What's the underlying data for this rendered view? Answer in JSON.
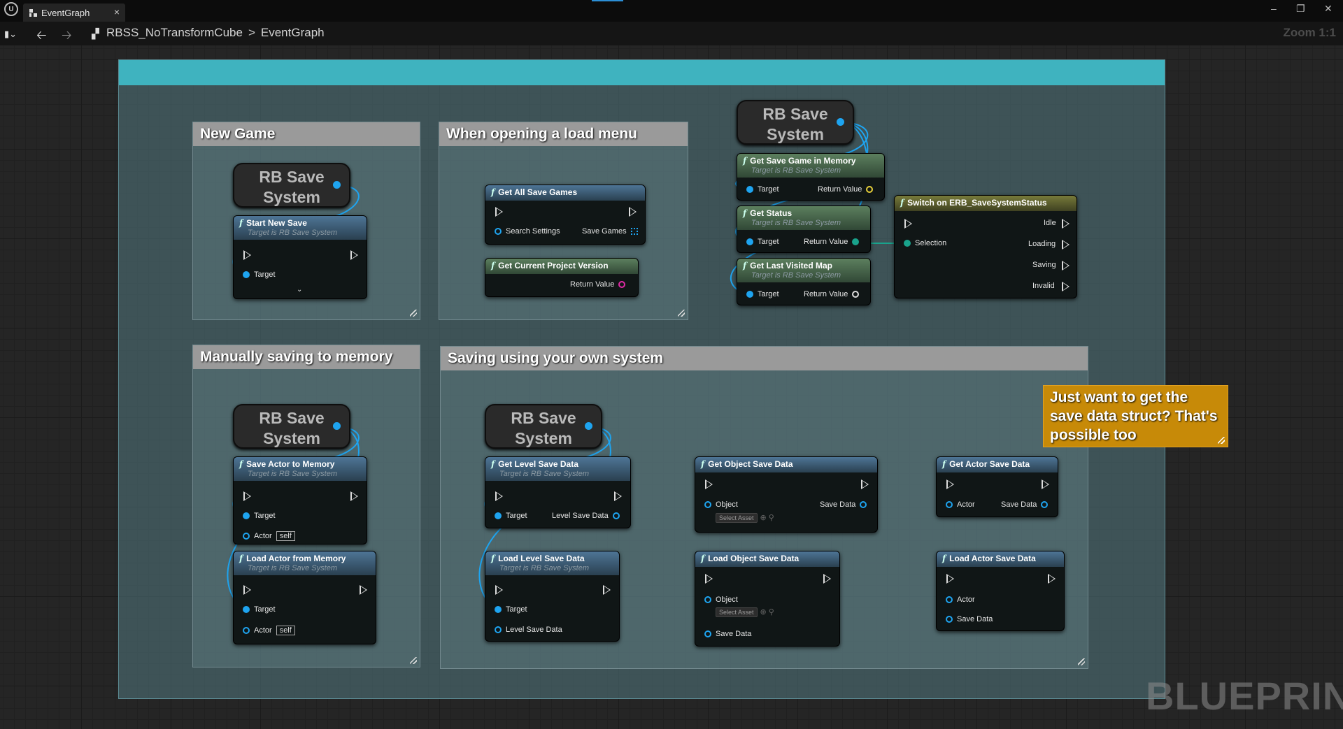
{
  "titlebar": {
    "tab_label": "EventGraph",
    "close": "×",
    "min": "–",
    "max": "❐",
    "win_close": "✕"
  },
  "nav": {
    "back": "🡠",
    "forward": "🡢",
    "asset": "RBSS_NoTransformCube",
    "sep": ">",
    "graph": "EventGraph",
    "zoom": "Zoom 1:1"
  },
  "comments": {
    "new_game": "New Game",
    "load_menu": "When opening a load menu",
    "manual": "Manually saving to memory",
    "own_system": "Saving using your own system",
    "note": "Just want to get the save data struct? That's possible too"
  },
  "var_label": "RB Save System",
  "target_sub": "Target is RB Save System",
  "pins": {
    "target": "Target",
    "return_value": "Return Value",
    "actor": "Actor",
    "self": "self",
    "object": "Object",
    "save_data": "Save Data",
    "select_asset": "Select Asset",
    "level_save_data": "Level Save Data",
    "search_settings": "Search Settings",
    "save_games": "Save Games",
    "selection": "Selection",
    "idle": "Idle",
    "loading": "Loading",
    "saving": "Saving",
    "invalid": "Invalid"
  },
  "nodes": {
    "start_new_save": "Start New Save",
    "get_all_save_games": "Get All Save Games",
    "get_current_project_version": "Get Current Project Version",
    "get_save_game_in_memory": "Get Save Game in Memory",
    "get_status": "Get Status",
    "get_last_visited_map": "Get Last Visited Map",
    "switch_status": "Switch on ERB_SaveSystemStatus",
    "save_actor_to_memory": "Save Actor to Memory",
    "load_actor_from_memory": "Load Actor from Memory",
    "get_level_save_data": "Get Level Save Data",
    "load_level_save_data": "Load Level Save Data",
    "get_object_save_data": "Get Object Save Data",
    "load_object_save_data": "Load Object Save Data",
    "get_actor_save_data": "Get Actor Save Data",
    "load_actor_save_data": "Load Actor Save Data"
  },
  "watermark": "BLUEPRINT",
  "colors": {
    "comment_header": "#3fb3bf",
    "note": "#c78a08",
    "pin_blue": "#1ea4f0"
  }
}
